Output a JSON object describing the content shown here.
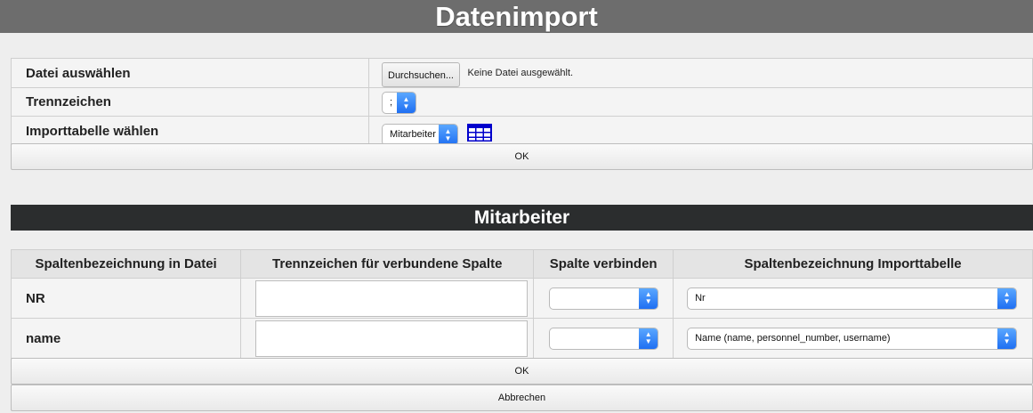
{
  "header": {
    "title": "Datenimport"
  },
  "import_form": {
    "file_label": "Datei auswählen",
    "file_button": "Durchsuchen...",
    "file_status": "Keine Datei ausgewählt.",
    "separator_label": "Trennzeichen",
    "separator_value": ";",
    "table_label": "Importtabelle wählen",
    "table_value": "Mitarbeiter",
    "ok_label": "OK"
  },
  "mapping": {
    "title": "Mitarbeiter",
    "columns": [
      "Spaltenbezeichnung in Datei",
      "Trennzeichen für verbundene Spalte",
      "Spalte verbinden",
      "Spaltenbezeichnung Importtabelle"
    ],
    "rows": [
      {
        "file_column": "NR",
        "separator": "",
        "join": "",
        "target": "Nr"
      },
      {
        "file_column": "name",
        "separator": "",
        "join": "",
        "target": "Name (name, personnel_number, username)"
      }
    ],
    "ok_label": "OK",
    "cancel_label": "Abbrechen"
  },
  "icons": {
    "select_arrows": "updown-chevron-icon",
    "table": "table-grid-icon"
  },
  "colors": {
    "header_bg": "#6d6d6d",
    "section_bg": "#2b2d2e",
    "select_accent": "#2f7df6",
    "table_icon": "#0000cc"
  }
}
